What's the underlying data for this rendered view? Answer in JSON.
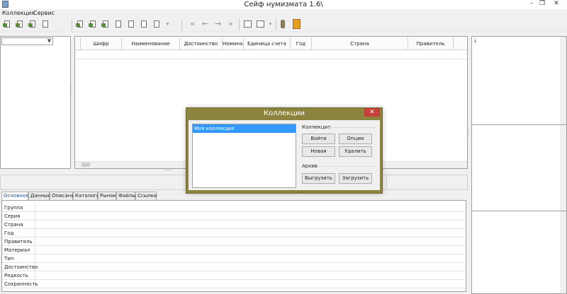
{
  "window": {
    "title": "Сейф нумизмата 1.6\\",
    "controls": [
      "–",
      "❐",
      "✕"
    ]
  },
  "menu": [
    "Коллекция",
    "Сервис"
  ],
  "grid": {
    "columns": [
      "Шифр",
      "Наименование",
      "Достоинство",
      "Номинал",
      "Единица счета",
      "Год",
      "Страна",
      "Правитель"
    ]
  },
  "tabs": [
    "Основное",
    "Данные",
    "Описание",
    "Каталоги",
    "Рынок",
    "Файлы",
    "Ссылки"
  ],
  "active_tab": "Основное",
  "properties": [
    "Группа",
    "Серия",
    "Страна",
    "Год",
    "Правитель",
    "Материал",
    "Тип",
    "Достоинство",
    "Редкость",
    "Сохранность"
  ],
  "dialog": {
    "title": "Коллекции",
    "close": "✕",
    "collections": [
      "Моя коллекция"
    ],
    "group_collection": "Коллекция",
    "btn_enter": "Войти",
    "btn_options": "Опции",
    "btn_new": "Новая",
    "btn_delete": "Удалить",
    "group_archive": "Архив",
    "btn_export": "Выгрузить",
    "btn_import": "Загрузить",
    "colors": {
      "frame": "#8c843e",
      "close": "#c7403a",
      "selection": "#3399ff"
    }
  },
  "icons": {
    "file_toolbar": [
      "new-collection-icon",
      "open-icon",
      "edit-icon",
      "print-icon"
    ],
    "item_toolbar": [
      "add-item-icon",
      "copy-item-icon",
      "edit-item-icon",
      "delete-item-icon",
      "move-item-icon",
      "export-item-icon",
      "print-item-icon"
    ],
    "nav": [
      "first-icon",
      "prev-icon",
      "next-icon",
      "last-icon"
    ],
    "view": [
      "table-view-icon",
      "list-view-icon",
      "filter-icon",
      "book-icon"
    ]
  }
}
